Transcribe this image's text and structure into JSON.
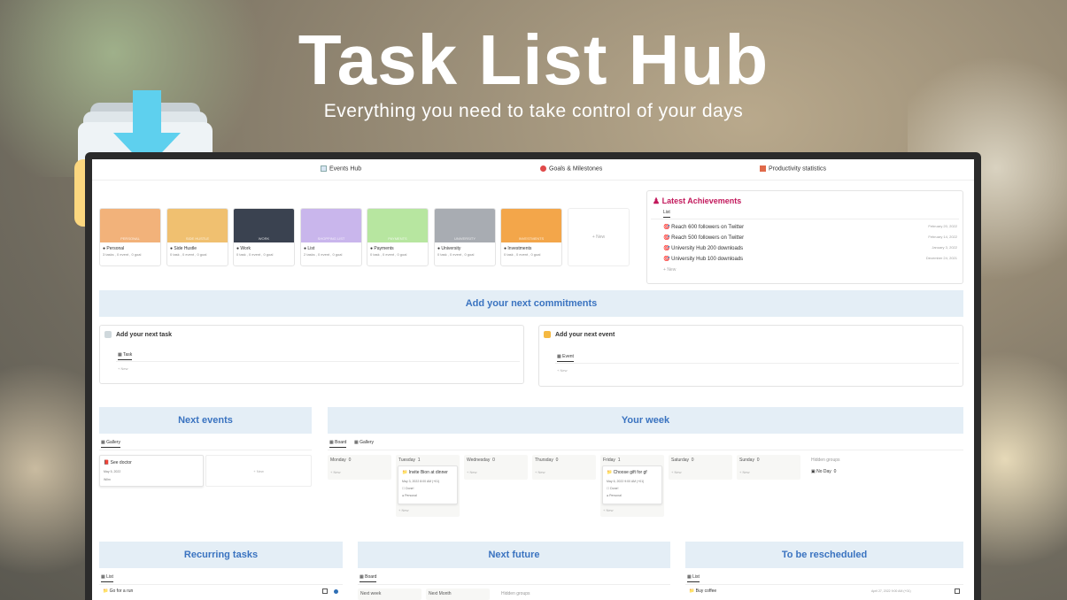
{
  "hero": {
    "title": "Task List Hub",
    "subtitle": "Everything you need to take control of your days"
  },
  "nav": {
    "events_hub": "Events Hub",
    "goals": "Goals & Milestones",
    "stats": "Productivity statistics"
  },
  "cards": [
    {
      "name": "Personal",
      "meta": "3 tasks , 0 event , 0 goal",
      "cover": "PERSONAL",
      "color": "#f2b27a"
    },
    {
      "name": "Side Hustle",
      "meta": "0 task , 0 event , 0 goal",
      "cover": "SIDE HUSTLE",
      "color": "#f0c070"
    },
    {
      "name": "Work",
      "meta": "0 task , 0 event , 0 goal",
      "cover": "WORK",
      "color": "#3a4250"
    },
    {
      "name": "List",
      "meta": "2 tasks , 0 event , 0 goal",
      "cover": "SHOPPING LIST",
      "color": "#c9b6ec"
    },
    {
      "name": "Payments",
      "meta": "0 task , 0 event , 0 goal",
      "cover": "PAYMENTS",
      "color": "#b7e6a0"
    },
    {
      "name": "University",
      "meta": "0 task , 0 event , 0 goal",
      "cover": "UNIVERSITY",
      "color": "#a8acb2"
    },
    {
      "name": "Investments",
      "meta": "0 task , 0 event , 0 goal",
      "cover": "INVESTMENTS",
      "color": "#f3a64a"
    }
  ],
  "new_label": "New",
  "achievements": {
    "title": "Latest Achievements",
    "tab": "List",
    "items": [
      {
        "text": "Reach 600 followers on Twitter",
        "date": "February 20, 2022"
      },
      {
        "text": "Reach 500 followers on Twitter",
        "date": "February 14, 2022"
      },
      {
        "text": "University Hub 200 downloads",
        "date": "January 3, 2022"
      },
      {
        "text": "University Hub 100 downloads",
        "date": "December 24, 2021"
      }
    ]
  },
  "commitments": {
    "banner": "Add your next commitments",
    "task_title": "Add your next task",
    "task_tab": "Task",
    "event_title": "Add your next event",
    "event_tab": "Event"
  },
  "next_events": {
    "banner": "Next events",
    "tab": "Gallery",
    "card_title": "See doctor",
    "card_date": "May 5, 2022",
    "card_tag": "Wilm"
  },
  "your_week": {
    "banner": "Your week",
    "tab_board": "Board",
    "tab_gallery": "Gallery",
    "columns": [
      {
        "name": "Monday",
        "count": "0"
      },
      {
        "name": "Tuesday",
        "count": "1"
      },
      {
        "name": "Wednesday",
        "count": "0"
      },
      {
        "name": "Thursday",
        "count": "0"
      },
      {
        "name": "Friday",
        "count": "1"
      },
      {
        "name": "Saturday",
        "count": "0"
      },
      {
        "name": "Sunday",
        "count": "0"
      }
    ],
    "hidden_groups": "Hidden groups",
    "no_day": "No Day",
    "no_day_count": "0",
    "tuesday_card": {
      "title": "Invite Bion at dinner",
      "date": "May 3, 2022 8:00 AM (+01)",
      "status": "Done!",
      "area": "Personal"
    },
    "friday_card": {
      "title": "Choose gift for gf",
      "date": "May 6, 2022 9:00 AM (+01)",
      "status": "Done!",
      "area": "Personal"
    }
  },
  "recurring": {
    "banner": "Recurring tasks",
    "tab": "List",
    "item": "Go for a run"
  },
  "future": {
    "banner": "Next future",
    "tab": "Board",
    "col1": "Next week",
    "col2": "Next Month",
    "hidden": "Hidden groups"
  },
  "reschedule": {
    "banner": "To be rescheduled",
    "tab": "List",
    "item": "Buy coffee",
    "date": "April 27, 2022 9:00 AM (+01)"
  }
}
